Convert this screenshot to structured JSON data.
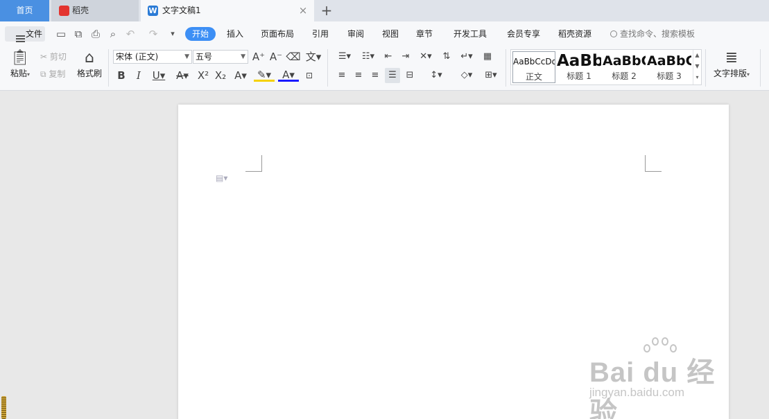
{
  "tabs": {
    "home": "首页",
    "docer": "稻壳",
    "document": "文字文稿1",
    "close": "×",
    "add": "+"
  },
  "menu": {
    "file": "文件",
    "items": [
      "开始",
      "插入",
      "页面布局",
      "引用",
      "审阅",
      "视图",
      "章节",
      "开发工具",
      "会员专享",
      "稻壳资源"
    ],
    "search": "查找命令、搜索模板"
  },
  "ribbon": {
    "paste": "粘贴",
    "cut": "剪切",
    "copy": "复制",
    "format_painter": "格式刷",
    "font_name": "宋体 (正文)",
    "font_size": "五号",
    "styles": [
      {
        "preview": "AaBbCcDd",
        "label": "正文"
      },
      {
        "preview": "AaBb",
        "label": "标题 1"
      },
      {
        "preview": "AaBbC",
        "label": "标题 2"
      },
      {
        "preview": "AaBbC",
        "label": "标题 3"
      }
    ],
    "text_layout": "文字排版"
  },
  "watermark": {
    "brand": "Bai du 经验",
    "url": "jingyan.baidu.com"
  },
  "colors": {
    "accent": "#3d8ff5",
    "home_tab": "#4a90e2",
    "docer_red": "#e3342f",
    "doc_blue": "#2b7bd6",
    "highlight": "#f5d100",
    "font_color": "#1a1aff"
  }
}
